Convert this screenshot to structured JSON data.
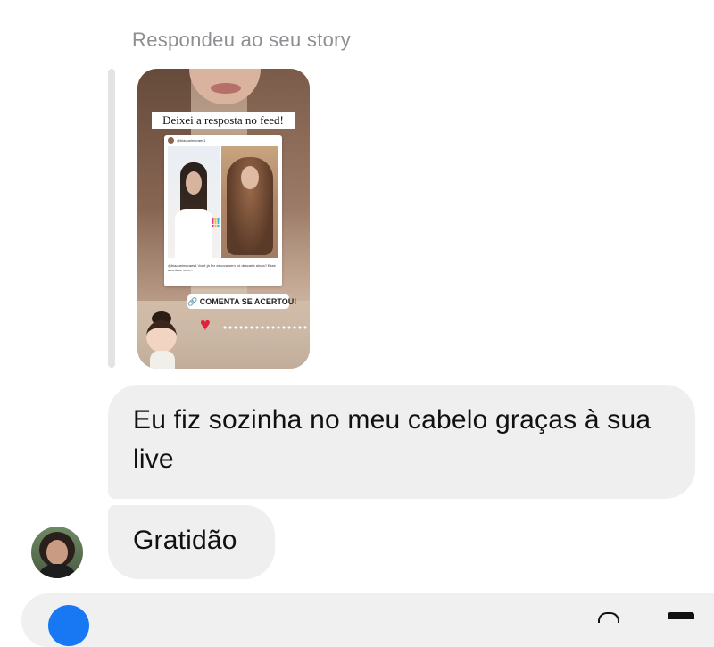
{
  "story_reply": {
    "label": "Respondeu ao seu story",
    "story": {
      "caption": "Deixei a resposta no feed!",
      "post_user": "@biaqueimoraes1",
      "post_text": "@biaqueimoraes1 Você já fez escova sem pó descarte ainda? Esse acontece com...",
      "cta": "COMENTA SE ACERTOU!",
      "marks": [
        "!",
        "!",
        "!"
      ]
    }
  },
  "messages": [
    {
      "text": "Eu fiz sozinha no meu cabelo graças à sua live"
    },
    {
      "text": "Gratidão"
    }
  ],
  "colors": {
    "bubble": "#efefef",
    "label": "#8e8e93",
    "accent": "#1877f2"
  }
}
